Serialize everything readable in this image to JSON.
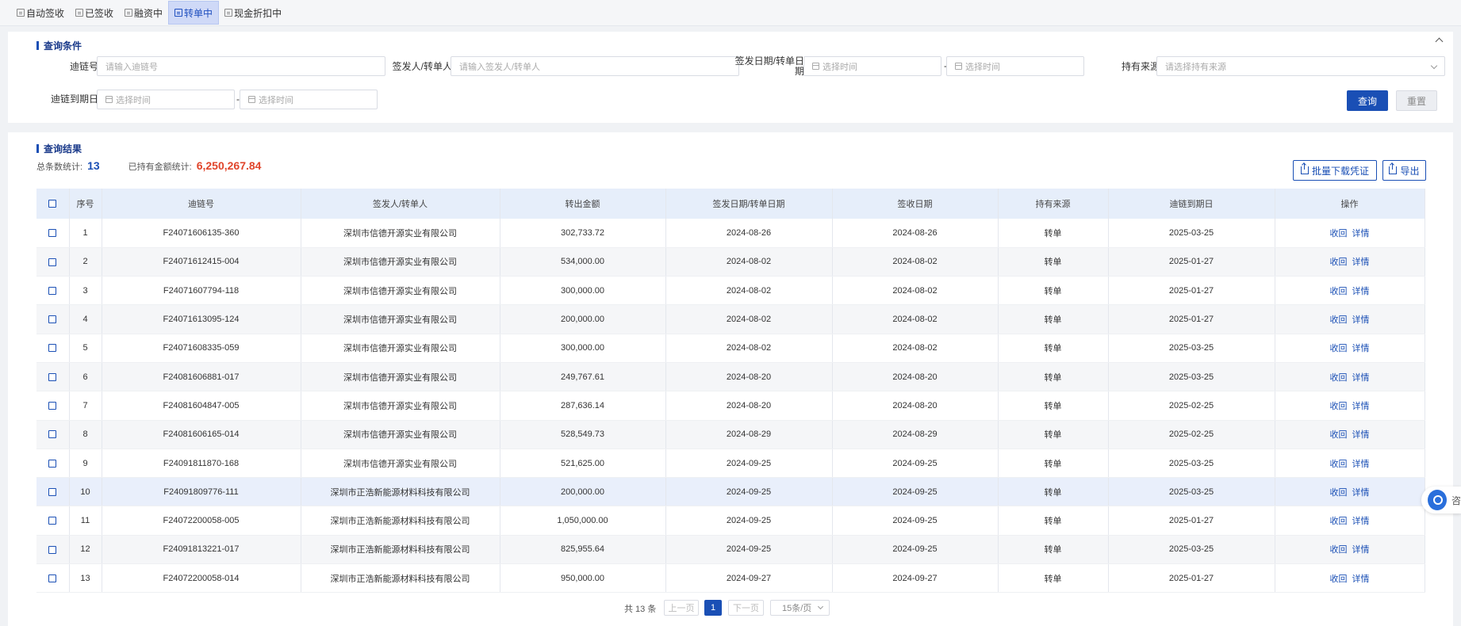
{
  "tabs": [
    {
      "label": "自动签收",
      "active": false
    },
    {
      "label": "已签收",
      "active": false
    },
    {
      "label": "融资中",
      "active": false
    },
    {
      "label": "转单中",
      "active": true
    },
    {
      "label": "现金折扣中",
      "active": false
    }
  ],
  "search": {
    "title": "查询条件",
    "chain_no_label": "迪链号",
    "chain_no_placeholder": "请输入迪链号",
    "issuer_label": "签发人/转单人",
    "issuer_placeholder": "请输入签发人/转单人",
    "issue_date_label": "签发日期/转单日期",
    "start_placeholder": "选择时间",
    "end_placeholder": "选择时间",
    "range_sep": "-",
    "source_label": "持有来源",
    "source_placeholder": "请选择持有来源",
    "due_date_label": "迪链到期日",
    "due_start_placeholder": "选择时间",
    "due_end_placeholder": "选择时间",
    "query_button": "查询",
    "reset_button": "重置"
  },
  "results": {
    "title": "查询结果",
    "total_label": "总条数统计:",
    "total_value": "13",
    "amount_label": "已持有金额统计:",
    "amount_value": "6,250,267.84",
    "batch_download_button": "批量下载凭证",
    "export_button": "导出"
  },
  "table": {
    "headers": [
      "序号",
      "迪链号",
      "签发人/转单人",
      "转出金额",
      "签发日期/转单日期",
      "签收日期",
      "持有来源",
      "迪链到期日",
      "操作"
    ],
    "action_recall": "收回",
    "action_detail": "详情",
    "rows": [
      {
        "no": "1",
        "chain": "F24071606135-360",
        "issuer": "深圳市信德开源实业有限公司",
        "amount": "302,733.72",
        "issue_date": "2024-08-26",
        "sign_date": "2024-08-26",
        "source": "转单",
        "due": "2025-03-25"
      },
      {
        "no": "2",
        "chain": "F24071612415-004",
        "issuer": "深圳市信德开源实业有限公司",
        "amount": "534,000.00",
        "issue_date": "2024-08-02",
        "sign_date": "2024-08-02",
        "source": "转单",
        "due": "2025-01-27"
      },
      {
        "no": "3",
        "chain": "F24071607794-118",
        "issuer": "深圳市信德开源实业有限公司",
        "amount": "300,000.00",
        "issue_date": "2024-08-02",
        "sign_date": "2024-08-02",
        "source": "转单",
        "due": "2025-01-27"
      },
      {
        "no": "4",
        "chain": "F24071613095-124",
        "issuer": "深圳市信德开源实业有限公司",
        "amount": "200,000.00",
        "issue_date": "2024-08-02",
        "sign_date": "2024-08-02",
        "source": "转单",
        "due": "2025-01-27"
      },
      {
        "no": "5",
        "chain": "F24071608335-059",
        "issuer": "深圳市信德开源实业有限公司",
        "amount": "300,000.00",
        "issue_date": "2024-08-02",
        "sign_date": "2024-08-02",
        "source": "转单",
        "due": "2025-03-25"
      },
      {
        "no": "6",
        "chain": "F24081606881-017",
        "issuer": "深圳市信德开源实业有限公司",
        "amount": "249,767.61",
        "issue_date": "2024-08-20",
        "sign_date": "2024-08-20",
        "source": "转单",
        "due": "2025-03-25"
      },
      {
        "no": "7",
        "chain": "F24081604847-005",
        "issuer": "深圳市信德开源实业有限公司",
        "amount": "287,636.14",
        "issue_date": "2024-08-20",
        "sign_date": "2024-08-20",
        "source": "转单",
        "due": "2025-02-25"
      },
      {
        "no": "8",
        "chain": "F24081606165-014",
        "issuer": "深圳市信德开源实业有限公司",
        "amount": "528,549.73",
        "issue_date": "2024-08-29",
        "sign_date": "2024-08-29",
        "source": "转单",
        "due": "2025-02-25"
      },
      {
        "no": "9",
        "chain": "F24091811870-168",
        "issuer": "深圳市信德开源实业有限公司",
        "amount": "521,625.00",
        "issue_date": "2024-09-25",
        "sign_date": "2024-09-25",
        "source": "转单",
        "due": "2025-03-25"
      },
      {
        "no": "10",
        "chain": "F24091809776-111",
        "issuer": "深圳市正浩新能源材料科技有限公司",
        "amount": "200,000.00",
        "issue_date": "2024-09-25",
        "sign_date": "2024-09-25",
        "source": "转单",
        "due": "2025-03-25"
      },
      {
        "no": "11",
        "chain": "F24072200058-005",
        "issuer": "深圳市正浩新能源材料科技有限公司",
        "amount": "1,050,000.00",
        "issue_date": "2024-09-25",
        "sign_date": "2024-09-25",
        "source": "转单",
        "due": "2025-01-27"
      },
      {
        "no": "12",
        "chain": "F24091813221-017",
        "issuer": "深圳市正浩新能源材料科技有限公司",
        "amount": "825,955.64",
        "issue_date": "2024-09-25",
        "sign_date": "2024-09-25",
        "source": "转单",
        "due": "2025-03-25"
      },
      {
        "no": "13",
        "chain": "F24072200058-014",
        "issuer": "深圳市正浩新能源材料科技有限公司",
        "amount": "950,000.00",
        "issue_date": "2024-09-27",
        "sign_date": "2024-09-27",
        "source": "转单",
        "due": "2025-01-27"
      }
    ]
  },
  "pagination": {
    "total_text": "共 13 条",
    "prev": "上一页",
    "current": "1",
    "next": "下一页",
    "page_size": "15条/页"
  },
  "floating": {
    "label": "咨"
  },
  "colors": {
    "primary": "#1a4fb5",
    "amount": "#e0452b",
    "header_bg": "#e6eefa"
  }
}
